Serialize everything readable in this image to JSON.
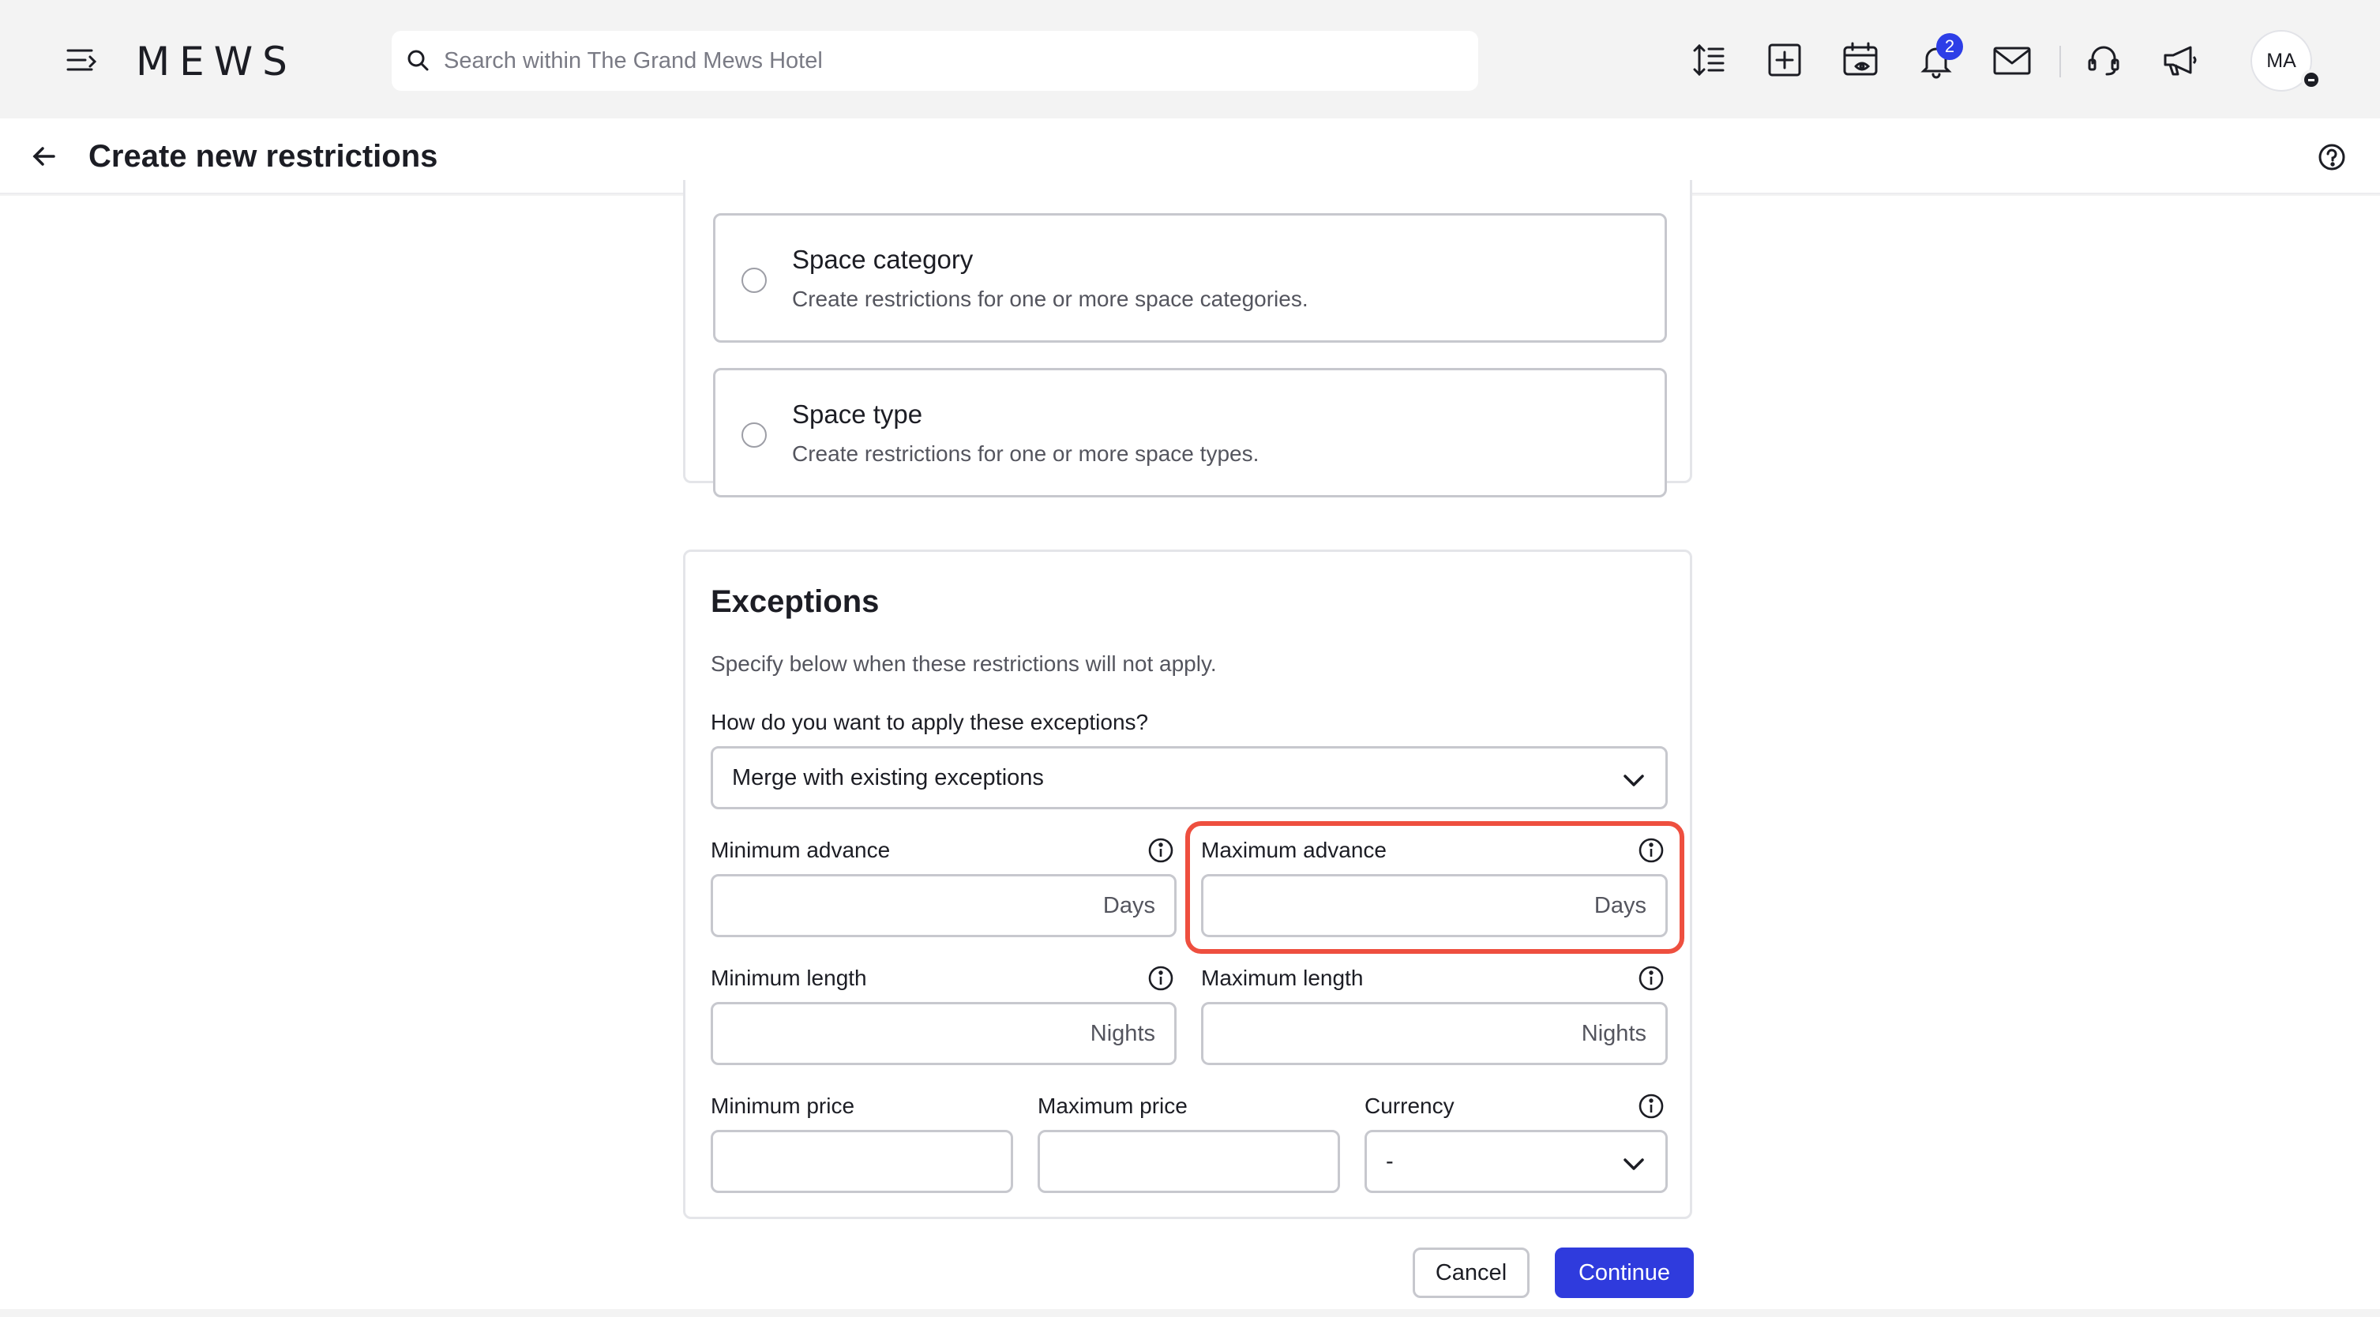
{
  "topbar": {
    "logo": "MEWS",
    "search_placeholder": "Search within The Grand Mews Hotel",
    "notifications_count": "2",
    "avatar_initials": "MA"
  },
  "header": {
    "title": "Create new restrictions"
  },
  "options": [
    {
      "title": "Space category",
      "description": "Create restrictions for one or more space categories."
    },
    {
      "title": "Space type",
      "description": "Create restrictions for one or more space types."
    }
  ],
  "exceptions": {
    "title": "Exceptions",
    "description": "Specify below when these restrictions will not apply.",
    "apply_label": "How do you want to apply these exceptions?",
    "apply_value": "Merge with existing exceptions",
    "min_advance_label": "Minimum advance",
    "max_advance_label": "Maximum advance",
    "advance_unit": "Days",
    "min_length_label": "Minimum length",
    "max_length_label": "Maximum length",
    "length_unit": "Nights",
    "min_price_label": "Minimum price",
    "max_price_label": "Maximum price",
    "currency_label": "Currency",
    "currency_value": "-"
  },
  "footer": {
    "cancel_label": "Cancel",
    "continue_label": "Continue"
  },
  "colors": {
    "accent": "#2f3bdd",
    "highlight": "#ee4f3f"
  }
}
